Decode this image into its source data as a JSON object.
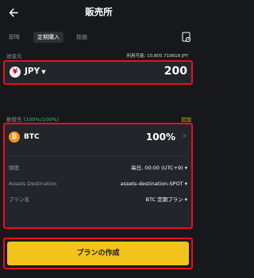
{
  "header": {
    "title": "販売所"
  },
  "tabs": [
    {
      "label": "即時"
    },
    {
      "label": "定期購入"
    },
    {
      "label": "指値"
    }
  ],
  "from": {
    "label": "送金元",
    "available_label": "利用可能:",
    "available_value": "10,805.719818 JPY",
    "currency": "JPY",
    "coin_symbol": "¥",
    "amount": "200"
  },
  "to": {
    "label_prefix": "振替先 (",
    "label_pct": "100%/100%",
    "label_suffix": ")",
    "add_label": "追加",
    "currency": "BTC",
    "coin_symbol": "₿",
    "percent": "100%",
    "close": "×"
  },
  "settings": {
    "frequency_label": "頻度",
    "frequency_value": "毎日, 00:00 (UTC+9)",
    "destination_label": "Assets Destination",
    "destination_value": "assets-destination-SPOT",
    "plan_name_label": "プラン名",
    "plan_name_value": "BTC 定期プラン"
  },
  "footer": {
    "create_label": "プランの作成"
  }
}
